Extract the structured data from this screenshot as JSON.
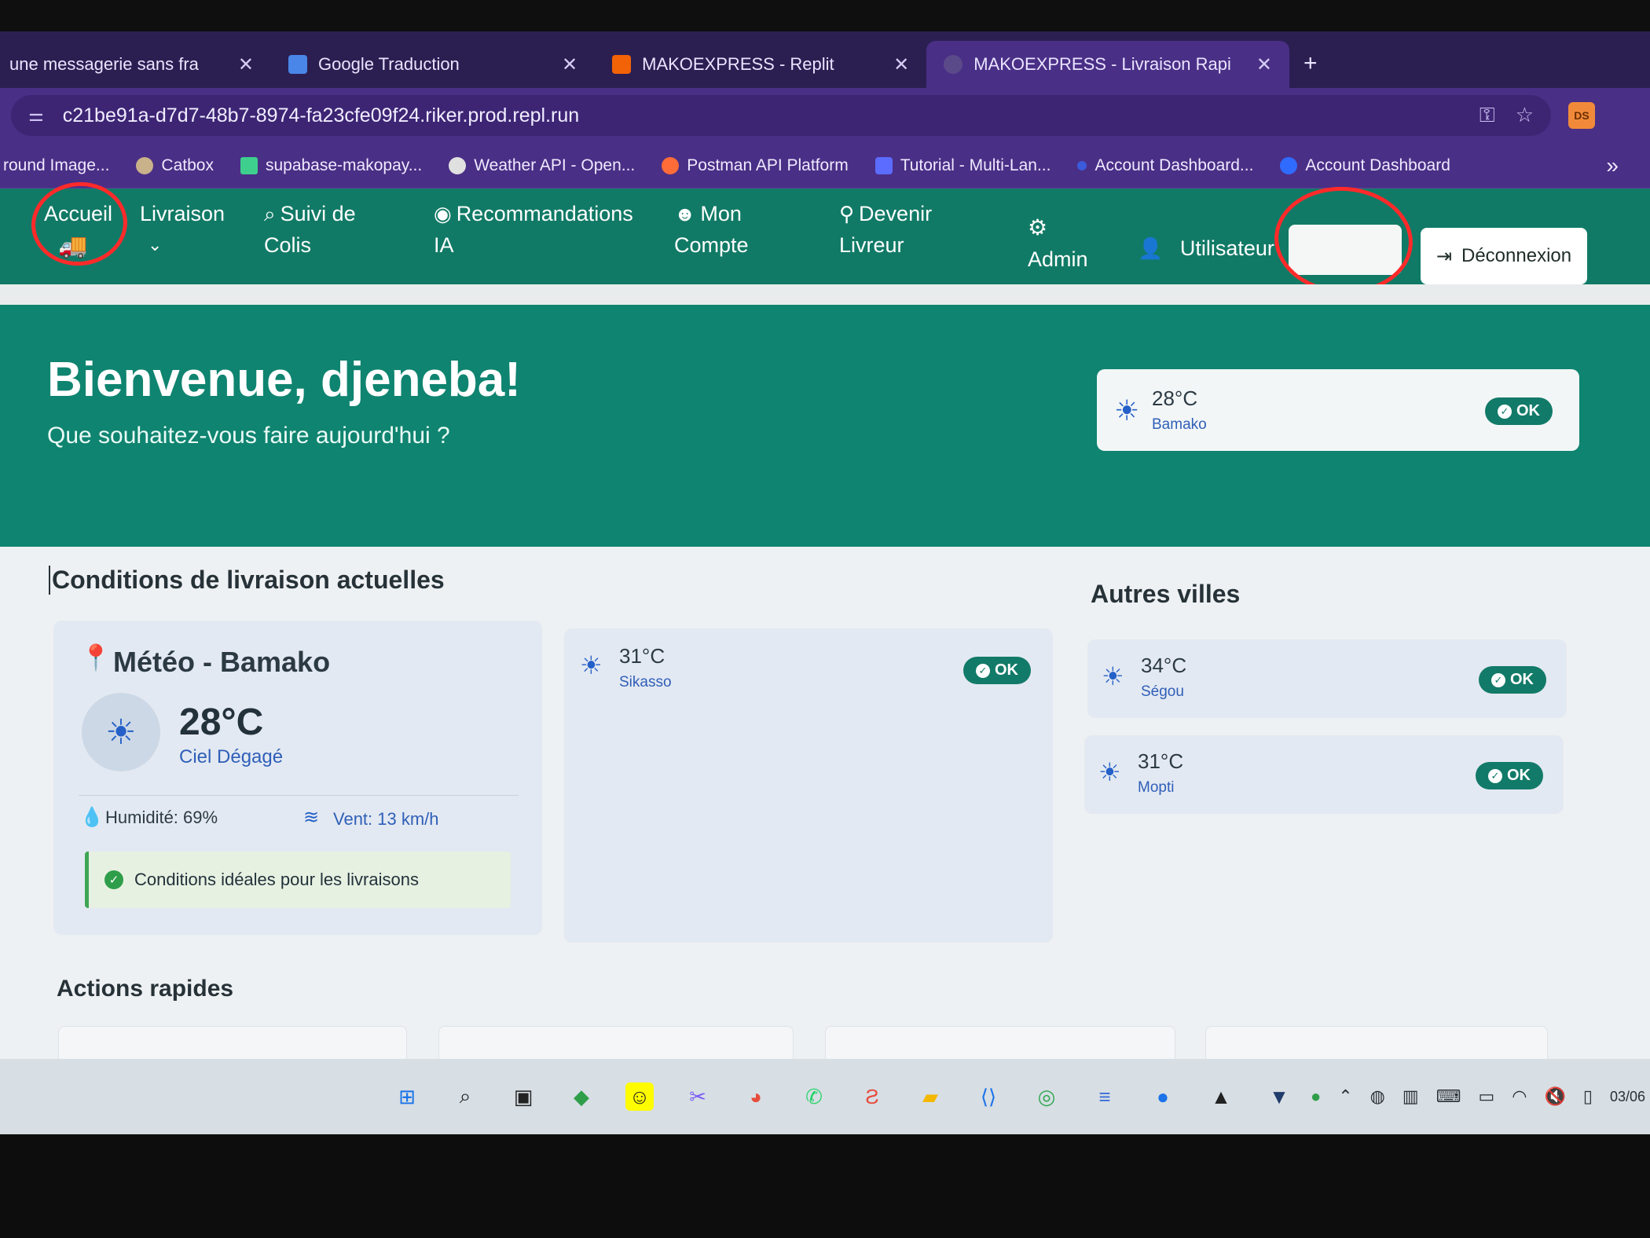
{
  "browser": {
    "tabs": [
      {
        "title": "une messagerie sans fra",
        "favicon_color": "#6a4fb0"
      },
      {
        "title": "Google Traduction",
        "favicon_color": "#4a86e8"
      },
      {
        "title": "MAKOEXPRESS - Replit",
        "favicon_color": "#f26207"
      },
      {
        "title": "MAKOEXPRESS - Livraison Rapi",
        "favicon_color": "#5b4a8a"
      }
    ],
    "new_tab": "+",
    "tab_close": "✕",
    "url": "c21be91a-d7d7-48b7-8974-fa23cfe09f24.riker.prod.repl.run",
    "profile_initials": "DS",
    "bookmarks": [
      {
        "label": "round Image...",
        "color": "#888"
      },
      {
        "label": "Catbox",
        "color": "#c9b28a"
      },
      {
        "label": "supabase-makopay...",
        "color": "#3ecf8e"
      },
      {
        "label": "Weather API - Open...",
        "color": "#e0e0e0"
      },
      {
        "label": "Postman API Platform",
        "color": "#ff6c37"
      },
      {
        "label": "Tutorial - Multi-Lan...",
        "color": "#5b6cff"
      },
      {
        "label": "Account Dashboard...",
        "color": "#3b5bdb"
      },
      {
        "label": "Account Dashboard",
        "color": "#2f6bff"
      }
    ],
    "bookmarks_more": "»"
  },
  "nav": {
    "accueil": "Accueil",
    "livraison": "Livraison",
    "suivi_1": "Suivi de",
    "suivi_2": "Colis",
    "reco_1": "Recommandations",
    "reco_2": "IA",
    "compte_1": "Mon",
    "compte_2": "Compte",
    "livreur_1": "Devenir",
    "livreur_2": "Livreur",
    "admin": "Admin",
    "user": "Utilisateur",
    "logout": "Déconnexion"
  },
  "hero": {
    "title": "Bienvenue, djeneba!",
    "subtitle": "Que souhaitez-vous faire aujourd'hui ?",
    "weather": {
      "temp": "28°C",
      "city": "Bamako",
      "status": "OK"
    }
  },
  "conditions": {
    "title": "Conditions de livraison actuelles",
    "main": {
      "heading": "Météo - Bamako",
      "temp": "28°C",
      "sky": "Ciel Dégagé",
      "humidity": "Humidité: 69%",
      "wind": "Vent: 13 km/h",
      "ideal": "Conditions idéales pour les livraisons"
    },
    "sikasso": {
      "temp": "31°C",
      "city": "Sikasso",
      "status": "OK"
    }
  },
  "other_cities": {
    "title": "Autres villes",
    "items": [
      {
        "temp": "34°C",
        "city": "Ségou",
        "status": "OK"
      },
      {
        "temp": "31°C",
        "city": "Mopti",
        "status": "OK"
      }
    ]
  },
  "quick_actions": {
    "title": "Actions rapides"
  },
  "tray": {
    "date": "03/06"
  },
  "colors": {
    "brand_green": "#0f8470",
    "nav_green": "#117a66",
    "browser_purple": "#4a2f86",
    "annotation_red": "#ff2a2a"
  }
}
